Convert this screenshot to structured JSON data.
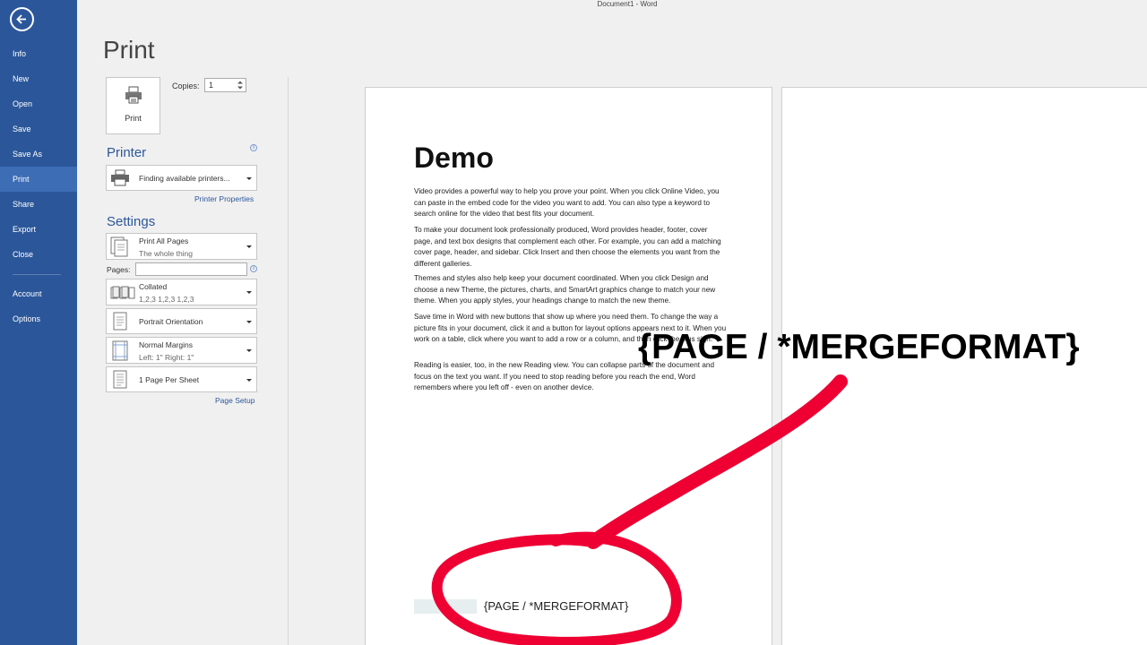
{
  "window": {
    "title": "Document1 - Word"
  },
  "sidebar": {
    "items": [
      {
        "label": "Info"
      },
      {
        "label": "New"
      },
      {
        "label": "Open"
      },
      {
        "label": "Save"
      },
      {
        "label": "Save As"
      },
      {
        "label": "Print",
        "active": true
      },
      {
        "label": "Share"
      },
      {
        "label": "Export"
      },
      {
        "label": "Close"
      },
      {
        "label": "Account"
      },
      {
        "label": "Options"
      }
    ]
  },
  "print_panel": {
    "heading": "Print",
    "print_button_label": "Print",
    "copies_label": "Copies:",
    "copies_value": "1",
    "printer_heading": "Printer",
    "printer_status": "Finding available printers...",
    "printer_properties_link": "Printer Properties",
    "settings_heading": "Settings",
    "settings": [
      {
        "title": "Print All Pages",
        "subtitle": "The whole thing"
      },
      {
        "title": "Collated",
        "subtitle": "1,2,3    1,2,3    1,2,3"
      },
      {
        "title": "Portrait Orientation",
        "subtitle": ""
      },
      {
        "title": "Normal Margins",
        "subtitle": "Left:  1\"    Right:  1\""
      },
      {
        "title": "1 Page Per Sheet",
        "subtitle": ""
      }
    ],
    "pages_label": "Pages:",
    "pages_value": "",
    "page_setup_link": "Page Setup"
  },
  "preview": {
    "doc_title": "Demo",
    "paragraphs": [
      "Video provides a powerful way to help you prove your point. When you click Online Video, you can paste in the embed code for the video you want to add. You can also type a keyword to search online for the video that best fits your document.",
      "To make your document look professionally produced, Word provides header, footer, cover page, and text box designs that complement each other. For example, you can add a matching cover page, header, and sidebar. Click Insert and then choose the elements you want from the different galleries.",
      "Themes and styles also help keep your document coordinated. When you click Design and choose a new Theme, the pictures, charts, and SmartArt graphics change to match your new theme. When you apply styles, your headings change to match the new theme.",
      "Save time in Word with new buttons that show up where you need them. To change the way a picture fits in your document, click it and a button for layout options appears next to it. When you work on a table, click where you want to add a row or a column, and then click the plus sign.",
      "Reading is easier, too, in the new Reading view. You can collapse parts of the document and focus on the text you want. If you need to stop reading before you reach the end, Word remembers where you left off - even on another device."
    ],
    "footer_field": "{PAGE / *MERGEFORMAT}"
  },
  "annotation": {
    "callout_text": "{PAGE / *MERGEFORMAT}",
    "stroke_color": "#ee0033"
  },
  "colors": {
    "accent": "#2b579a",
    "sidebar_active": "#3d6db5"
  }
}
